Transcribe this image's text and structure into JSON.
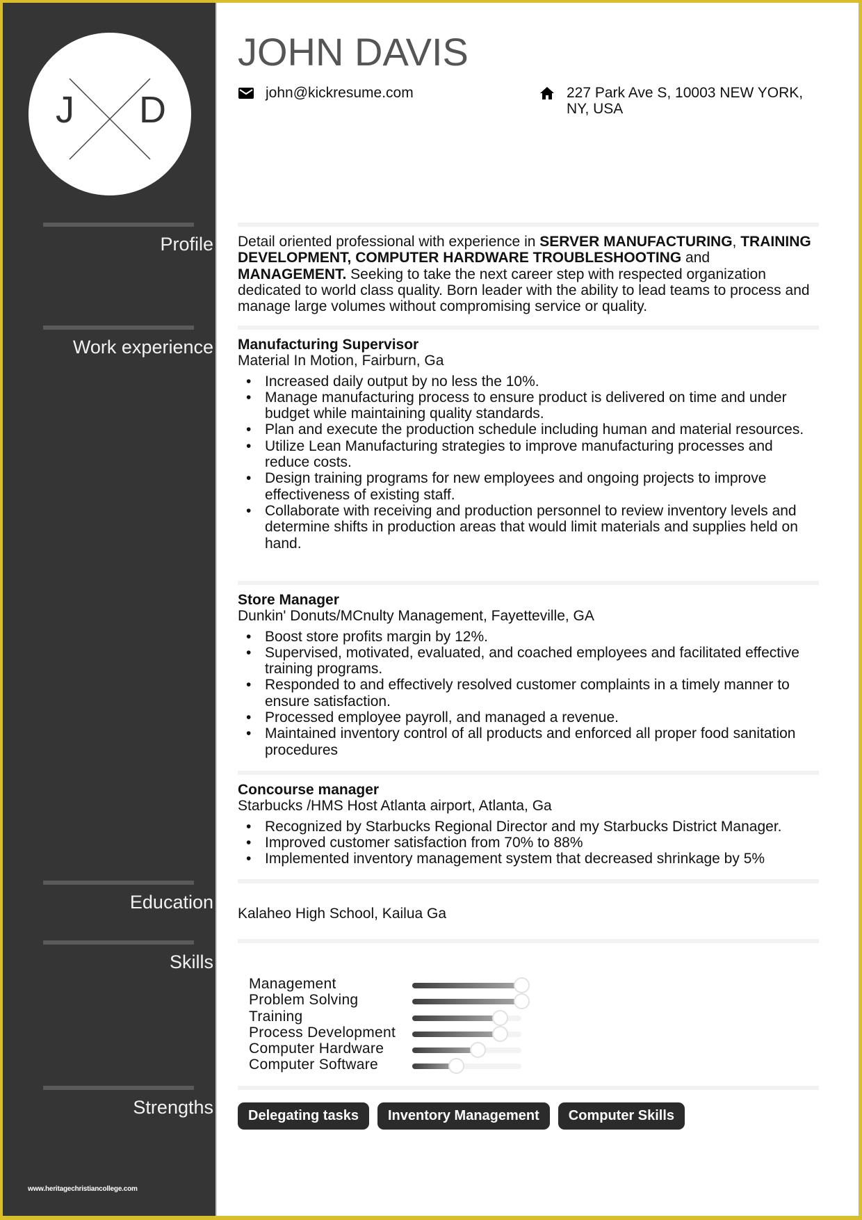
{
  "theme": {
    "sidebar_bg": "#353535",
    "border_accent": "#d9be2b",
    "chip_bg": "#2b2b2b"
  },
  "avatar": {
    "initial_left": "J",
    "initial_right": "D"
  },
  "header": {
    "name": "JOHN DAVIS",
    "email_icon": "envelope-icon",
    "email": "john@kickresume.com",
    "address_icon": "home-icon",
    "address": "227 Park Ave S, 10003 NEW YORK, NY, USA"
  },
  "sections": {
    "profile": "Profile",
    "work": "Work experience",
    "education": "Education",
    "skills": "Skills",
    "strengths": "Strengths"
  },
  "profile": {
    "p1": "Detail oriented professional with experience in ",
    "b1": "SERVER MANUFACTURING",
    "p2": ", ",
    "b2": "TRAINING DEVELOPMENT, COMPUTER HARDWARE TROUBLESHOOTING",
    "p3": " and ",
    "b3": "MANAGEMENT.",
    "p4": " Seeking to take the next career step with respected organization dedicated to world class quality. Born leader with the ability to lead teams to process and manage large volumes without compromising service or quality."
  },
  "jobs": [
    {
      "title": "Manufacturing Supervisor",
      "company": "Material In Motion, Fairburn, Ga",
      "bullets": [
        "Increased daily output by no less the 10%.",
        "Manage manufacturing process to ensure product is delivered on time and under budget while maintaining quality standards.",
        "Plan and execute the production schedule including human and material resources.",
        "Utilize Lean Manufacturing strategies to improve manufacturing processes and reduce costs.",
        "Design training programs for new employees and ongoing projects to improve effectiveness of existing staff.",
        "Collaborate with receiving and production personnel to review inventory levels and determine shifts in production areas that would limit materials and supplies held on hand."
      ]
    },
    {
      "title": "Store Manager",
      "company": "Dunkin' Donuts/MCnulty Management, Fayetteville, GA",
      "bullets": [
        "Boost store profits margin by 12%.",
        "Supervised, motivated, evaluated, and coached employees and facilitated effective training programs.",
        "Responded to and effectively resolved customer complaints in a timely manner to ensure satisfaction.",
        "Processed employee payroll, and managed a revenue.",
        "Maintained inventory control of all products and enforced all proper food sanitation procedures"
      ]
    },
    {
      "title": "Concourse manager",
      "company": "Starbucks /HMS Host Atlanta airport, Atlanta, Ga",
      "bullets": [
        "Recognized by Starbucks Regional Director and my Starbucks District Manager.",
        "Improved customer satisfaction from 70% to 88%",
        "Implemented inventory management system that decreased shrinkage by 5%"
      ]
    }
  ],
  "education": {
    "school": "Kalaheo High School, Kailua Ga"
  },
  "skills": [
    {
      "name": "Management",
      "level": 1.0
    },
    {
      "name": "Problem Solving",
      "level": 1.0
    },
    {
      "name": "Training",
      "level": 0.8
    },
    {
      "name": "Process Development",
      "level": 0.8
    },
    {
      "name": "Computer Hardware",
      "level": 0.6
    },
    {
      "name": "Computer Software",
      "level": 0.4
    }
  ],
  "strengths": [
    "Delegating tasks",
    "Inventory Management",
    "Computer Skills"
  ],
  "watermark": "www.heritagechristiancollege.com"
}
